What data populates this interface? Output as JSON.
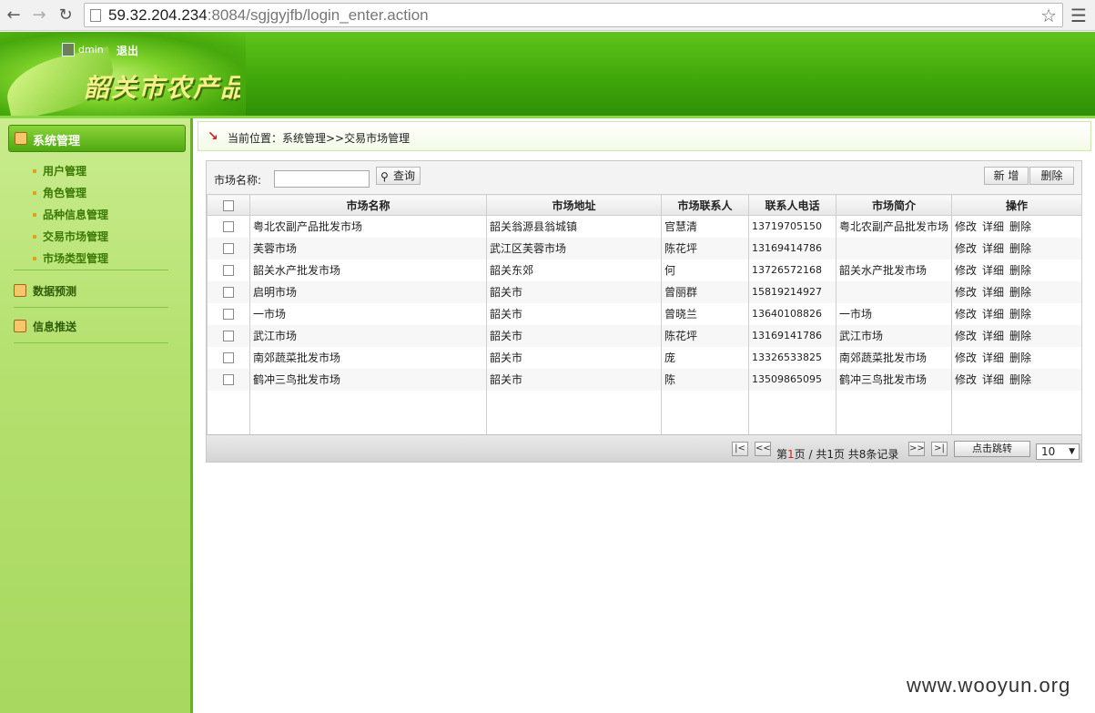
{
  "browser": {
    "url_host": "59.32.204.234",
    "url_rest": ":8084/sgjgyjfb/login_enter.action"
  },
  "header": {
    "user_name": "dmin",
    "logout_label": "退出",
    "site_title": "韶关市农产品"
  },
  "sidebar": {
    "section_title": "系统管理",
    "items": [
      {
        "label": "用户管理"
      },
      {
        "label": "角色管理"
      },
      {
        "label": "品种信息管理"
      },
      {
        "label": "交易市场管理"
      },
      {
        "label": "市场类型管理"
      }
    ],
    "groups": [
      {
        "label": "数据预测"
      },
      {
        "label": "信息推送"
      }
    ]
  },
  "breadcrumb": {
    "text": "当前位置：系统管理>>交易市场管理"
  },
  "toolbar": {
    "search_label": "市场名称:",
    "search_value": "",
    "search_button": "查询",
    "add_button": "新 增",
    "delete_button": "删除"
  },
  "table": {
    "columns": [
      "市场名称",
      "市场地址",
      "市场联系人",
      "联系人电话",
      "市场简介",
      "操作"
    ],
    "rows": [
      {
        "name": "粤北农副产品批发市场",
        "address": "韶关翁源县翁城镇",
        "contact": "官慧清",
        "phone": "13719705150",
        "intro": "粤北农副产品批发市场"
      },
      {
        "name": "芙蓉市场",
        "address": "武江区芙蓉市场",
        "contact": "陈花坪",
        "phone": "13169414786",
        "intro": ""
      },
      {
        "name": "韶关水产批发市场",
        "address": "韶关东郊",
        "contact": "何",
        "phone": "13726572168",
        "intro": "韶关水产批发市场"
      },
      {
        "name": "启明市场",
        "address": "韶关市",
        "contact": "曾丽群",
        "phone": "15819214927",
        "intro": ""
      },
      {
        "name": "一市场",
        "address": "韶关市",
        "contact": "曾晓兰",
        "phone": "13640108826",
        "intro": "一市场"
      },
      {
        "name": "武江市场",
        "address": "韶关市",
        "contact": "陈花坪",
        "phone": "13169141786",
        "intro": "武江市场"
      },
      {
        "name": "南郊蔬菜批发市场",
        "address": "韶关市",
        "contact": "庞",
        "phone": "13326533825",
        "intro": "南郊蔬菜批发市场"
      },
      {
        "name": "鹤冲三鸟批发市场",
        "address": "韶关市",
        "contact": "陈",
        "phone": "13509865095",
        "intro": "鹤冲三鸟批发市场"
      }
    ],
    "actions": {
      "edit": "修改",
      "detail": "详细",
      "delete": "删除"
    }
  },
  "pager": {
    "first": "|<",
    "prev": "<<",
    "next": ">>",
    "last": ">|",
    "page_prefix": "第",
    "current_page": "1",
    "page_suffix": "页 / 共1页 共8条记录",
    "jump_button": "点击跳转",
    "page_size": "10"
  },
  "watermark": "www.wooyun.org"
}
